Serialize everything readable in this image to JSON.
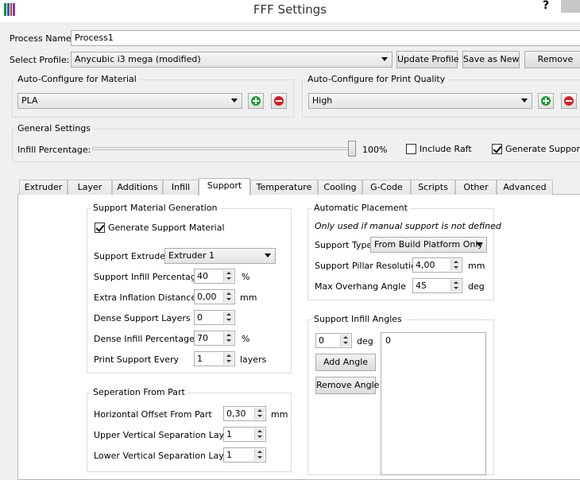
{
  "window": {
    "title": "FFF Settings",
    "help": "?",
    "icon": "app-logo-icon",
    "icon_colors": [
      "#1a8d3b",
      "#2d5fb4",
      "#c42f2f",
      "#7b3fa0"
    ]
  },
  "process": {
    "name_label": "Process Name:",
    "name_value": "Process1",
    "profile_label": "Select Profile:",
    "profile_value": "Anycubic i3 mega (modified)",
    "update_btn": "Update Profile",
    "save_as_new_btn": "Save as New",
    "remove_btn": "Remove"
  },
  "material": {
    "group_title": "Auto-Configure for Material",
    "value": "PLA"
  },
  "quality": {
    "group_title": "Auto-Configure for Print Quality",
    "value": "High"
  },
  "general": {
    "group_title": "General Settings",
    "infill_label": "Infill Percentage:",
    "infill_value": "100%",
    "infill_fraction": 1.0,
    "include_raft_label": "Include Raft",
    "include_raft_checked": false,
    "generate_support_label": "Generate Support",
    "generate_support_checked": true
  },
  "tabs": [
    {
      "label": "Extruder",
      "active": false
    },
    {
      "label": "Layer",
      "active": false
    },
    {
      "label": "Additions",
      "active": false
    },
    {
      "label": "Infill",
      "active": false
    },
    {
      "label": "Support",
      "active": true
    },
    {
      "label": "Temperature",
      "active": false
    },
    {
      "label": "Cooling",
      "active": false
    },
    {
      "label": "G-Code",
      "active": false
    },
    {
      "label": "Scripts",
      "active": false
    },
    {
      "label": "Other",
      "active": false
    },
    {
      "label": "Advanced",
      "active": false
    }
  ],
  "support_gen": {
    "title": "Support Material Generation",
    "generate_label": "Generate Support Material",
    "generate_checked": true,
    "extruder_label": "Support Extruder",
    "extruder_value": "Extruder 1",
    "infill_pct_label": "Support Infill Percentage",
    "infill_pct_value": "40",
    "infill_pct_unit": "%",
    "inflation_label": "Extra Inflation Distance",
    "inflation_value": "0,00",
    "inflation_unit": "mm",
    "dense_layers_label": "Dense Support Layers",
    "dense_layers_value": "0",
    "dense_infill_label": "Dense Infill Percentage",
    "dense_infill_value": "70",
    "dense_infill_unit": "%",
    "print_every_label": "Print Support Every",
    "print_every_value": "1",
    "print_every_unit": "layers"
  },
  "separation": {
    "title": "Seperation From Part",
    "horizontal_label": "Horizontal Offset From Part",
    "horizontal_value": "0,30",
    "horizontal_unit": "mm",
    "upper_label": "Upper Vertical Separation Layers",
    "upper_value": "1",
    "lower_label": "Lower Vertical Separation Layers",
    "lower_value": "1"
  },
  "auto_place": {
    "title": "Automatic Placement",
    "note": "Only used if manual support is not defined",
    "type_label": "Support Type",
    "type_value": "From Build Platform Only",
    "pillar_label": "Support Pillar Resolution",
    "pillar_value": "4,00",
    "pillar_unit": "mm",
    "overhang_label": "Max Overhang Angle",
    "overhang_value": "45",
    "overhang_unit": "deg"
  },
  "infill_angles": {
    "title": "Support Infill Angles",
    "angle_value": "0",
    "angle_unit": "deg",
    "add_btn": "Add Angle",
    "remove_btn": "Remove Angle",
    "list": [
      "0"
    ]
  }
}
